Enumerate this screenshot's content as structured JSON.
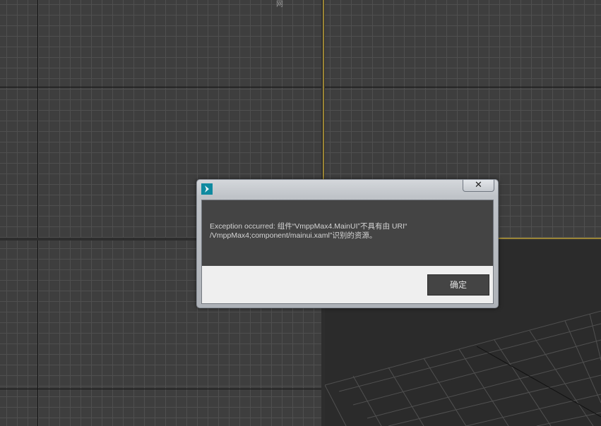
{
  "viewports": {
    "top_label": "网"
  },
  "dialog": {
    "title": "",
    "close_glyph": "✕",
    "message_line1": "Exception occurred: 组件“VmppMax4.MainUI”不具有由 URI“",
    "message_line2": "/VmppMax4;component/mainui.xaml”识别的资源。",
    "ok_label": "确定",
    "icon": "3ds-max-app-icon"
  },
  "colors": {
    "viewport_bg": "#3e3e3e",
    "grid_line": "#4f4f4f",
    "active_viewport_border": "#9a8536",
    "dialog_message_bg": "#444444",
    "dialog_footer_bg": "#efefef"
  }
}
